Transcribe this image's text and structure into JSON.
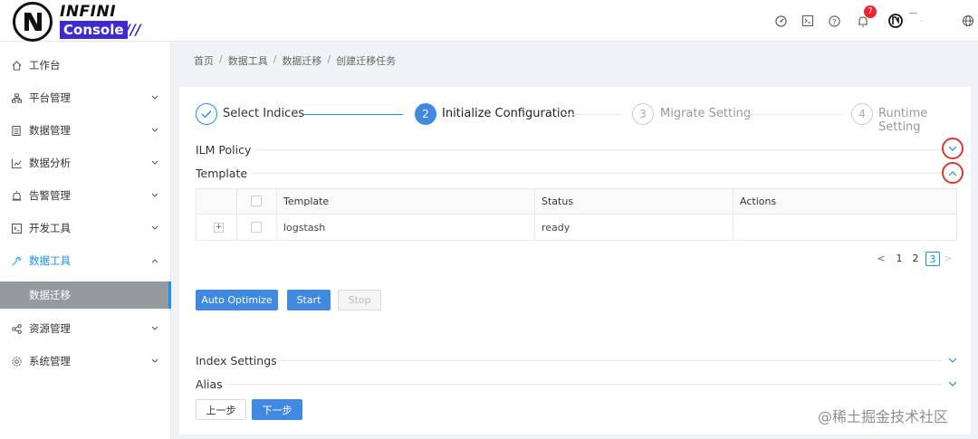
{
  "header": {
    "logo_top": "INFINI",
    "logo_bottom": "Console",
    "logo_slashes": "///",
    "notification_count": "7",
    "user_name": "▔ .",
    "icons": [
      "dashboard-icon",
      "terminal-icon",
      "help-icon",
      "bell-icon",
      "user-logo-icon",
      "globe-icon"
    ]
  },
  "sidebar": {
    "items": [
      {
        "label": "工作台",
        "icon": "home-icon"
      },
      {
        "label": "平台管理",
        "icon": "cluster-icon"
      },
      {
        "label": "数据管理",
        "icon": "database-icon"
      },
      {
        "label": "数据分析",
        "icon": "chart-icon"
      },
      {
        "label": "告警管理",
        "icon": "alarm-icon"
      },
      {
        "label": "开发工具",
        "icon": "code-icon"
      },
      {
        "label": "数据工具",
        "icon": "tool-icon"
      },
      {
        "label": "资源管理",
        "icon": "share-icon"
      },
      {
        "label": "系统管理",
        "icon": "settings-icon"
      }
    ],
    "active_sub": "数据迁移"
  },
  "breadcrumb": [
    "首页",
    "数据工具",
    "数据迁移",
    "创建迁移任务"
  ],
  "steps": [
    {
      "num": "",
      "label": "Select Indices",
      "state": "done"
    },
    {
      "num": "2",
      "label": "Initialize Configuration",
      "state": "active"
    },
    {
      "num": "3",
      "label": "Migrate Setting",
      "state": "wait"
    },
    {
      "num": "4",
      "label": "Runtime Setting",
      "state": "wait"
    }
  ],
  "sections": {
    "ilm": "ILM Policy",
    "template": "Template",
    "index_settings": "Index Settings",
    "alias": "Alias"
  },
  "table": {
    "headers": [
      "Template",
      "Status",
      "Actions"
    ],
    "rows": [
      {
        "template": "logstash",
        "status": "ready",
        "actions": ""
      }
    ],
    "expand_symbol": "+"
  },
  "pagination": {
    "prev": "<",
    "pages": [
      "1",
      "2",
      "3"
    ],
    "active_page": "3",
    "next": ">"
  },
  "buttons": {
    "auto_optimize": "Auto Optimize",
    "start": "Start",
    "stop": "Stop",
    "prev_step": "上一步",
    "next_step": "下一步"
  },
  "watermark": "@稀土掘金技术社区",
  "colors": {
    "primary": "#1890ff",
    "button_primary": "#3f8ae0",
    "highlight_ring": "#d93a2b",
    "submenu_bg": "#959a9e"
  }
}
